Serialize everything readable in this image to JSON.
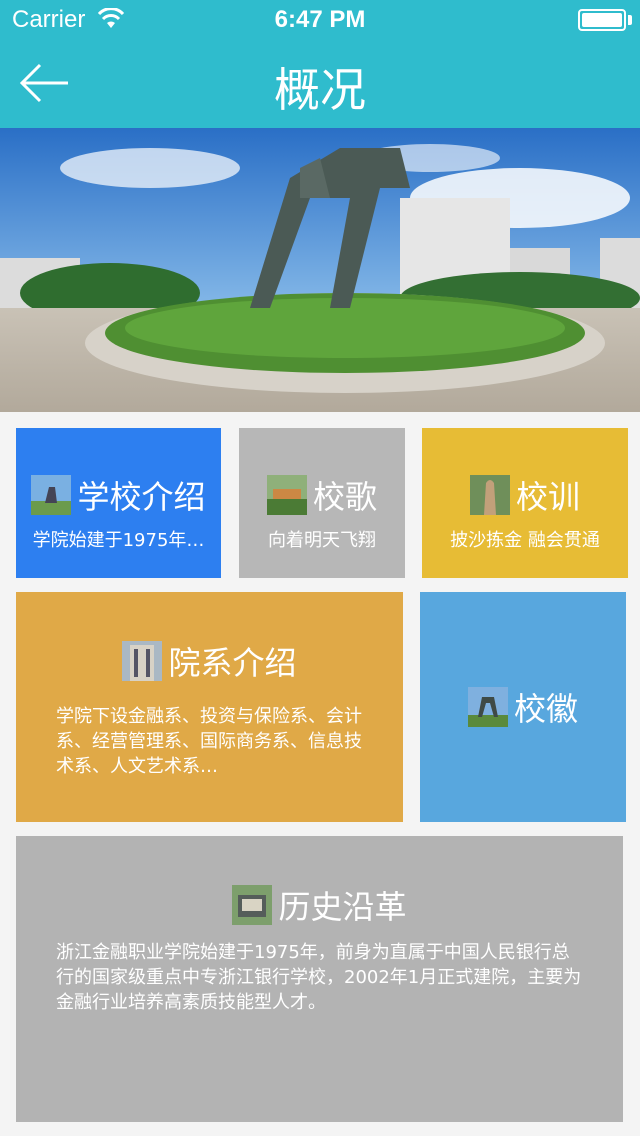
{
  "status_bar": {
    "carrier": "Carrier",
    "time": "6:47 PM"
  },
  "nav": {
    "title": "概况"
  },
  "tiles": {
    "intro": {
      "label": "学校介绍",
      "desc": "学院始建于1975年…"
    },
    "song": {
      "label": "校歌",
      "desc": "向着明天飞翔"
    },
    "motto": {
      "label": "校训",
      "desc": "披沙拣金  融会贯通"
    },
    "departments": {
      "label": "院系介绍",
      "desc": "学院下设金融系、投资与保险系、会计系、经营管理系、国际商务系、信息技术系、人文艺术系…"
    },
    "emblem": {
      "label": "校徽"
    },
    "history": {
      "label": "历史沿革",
      "desc": "浙江金融职业学院始建于1975年，前身为直属于中国人民银行总行的国家级重点中专浙江银行学校，2002年1月正式建院，主要为金融行业培养高素质技能型人才。"
    }
  },
  "colors": {
    "nav_bg": "#2fbccd",
    "intro": "#2d7ff0",
    "song": "#b7b7b7",
    "motto": "#e7bc35",
    "departments": "#e0a947",
    "emblem": "#58a7de",
    "history": "#b3b3b3"
  }
}
